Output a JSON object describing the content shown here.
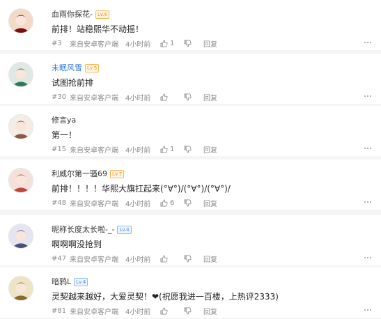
{
  "comments": [
    {
      "name": "血雨你探花-",
      "name_style": "plain",
      "badge": "Lv.6",
      "badge_style": "orange",
      "text": "前排！站稳熙华不动摇！",
      "floor": "#3",
      "source": "来自安卓客户端",
      "time": "4小时前",
      "likes": "1",
      "reply": "回复",
      "avatar_colors": [
        "#7a0f12",
        "#f3d9c8"
      ]
    },
    {
      "name": "未眠风雪",
      "name_style": "vip",
      "badge": "Lv.5",
      "badge_style": "orange",
      "text": "试图抢前排",
      "floor": "#30",
      "source": "来自安卓客户端",
      "time": "4小时前",
      "likes": "",
      "reply": "回复",
      "avatar_colors": [
        "#2d7a5b",
        "#dfe8e2"
      ]
    },
    {
      "name": "修言ya",
      "name_style": "plain",
      "badge": "",
      "badge_style": "",
      "text": "第一！",
      "floor": "#15",
      "source": "来自安卓客户端",
      "time": "4小时前",
      "likes": "1",
      "reply": "回复",
      "avatar_colors": [
        "#8a5a44",
        "#f6ece6"
      ]
    },
    {
      "name": "利威尔第一骚69",
      "name_style": "plain",
      "badge": "Lv.7",
      "badge_style": "orange",
      "text": "前排！！！！华熙大旗扛起来(°∀°)/(°∀°)/(°∀°)/",
      "floor": "#48",
      "source": "来自安卓客户端",
      "time": "4小时前",
      "likes": "6",
      "reply": "回复",
      "avatar_colors": [
        "#c0473a",
        "#f4e1dc"
      ]
    },
    {
      "name": "昵称长度太长啦-_-",
      "name_style": "plain",
      "badge": "Lv.4",
      "badge_style": "blue",
      "text": "啊啊啊没抢到",
      "floor": "#47",
      "source": "来自安卓客户端",
      "time": "4小时前",
      "likes": "",
      "reply": "回复",
      "avatar_colors": [
        "#4a4f78",
        "#e6e4ef"
      ]
    },
    {
      "name": "暗鸦L",
      "name_style": "plain",
      "badge": "Lv.4",
      "badge_style": "blue",
      "text": "灵契越来越好，大爱灵契！❤(祝愿我进一百楼，上热评2333)",
      "floor": "#81",
      "source": "来自安卓客户端",
      "time": "4小时前",
      "likes": "",
      "reply": "回复",
      "avatar_colors": [
        "#8a6a2a",
        "#efe3c5"
      ]
    }
  ],
  "icons": {
    "like": "thumbs-up-icon",
    "dislike": "thumbs-down-icon",
    "more": "more-icon"
  }
}
